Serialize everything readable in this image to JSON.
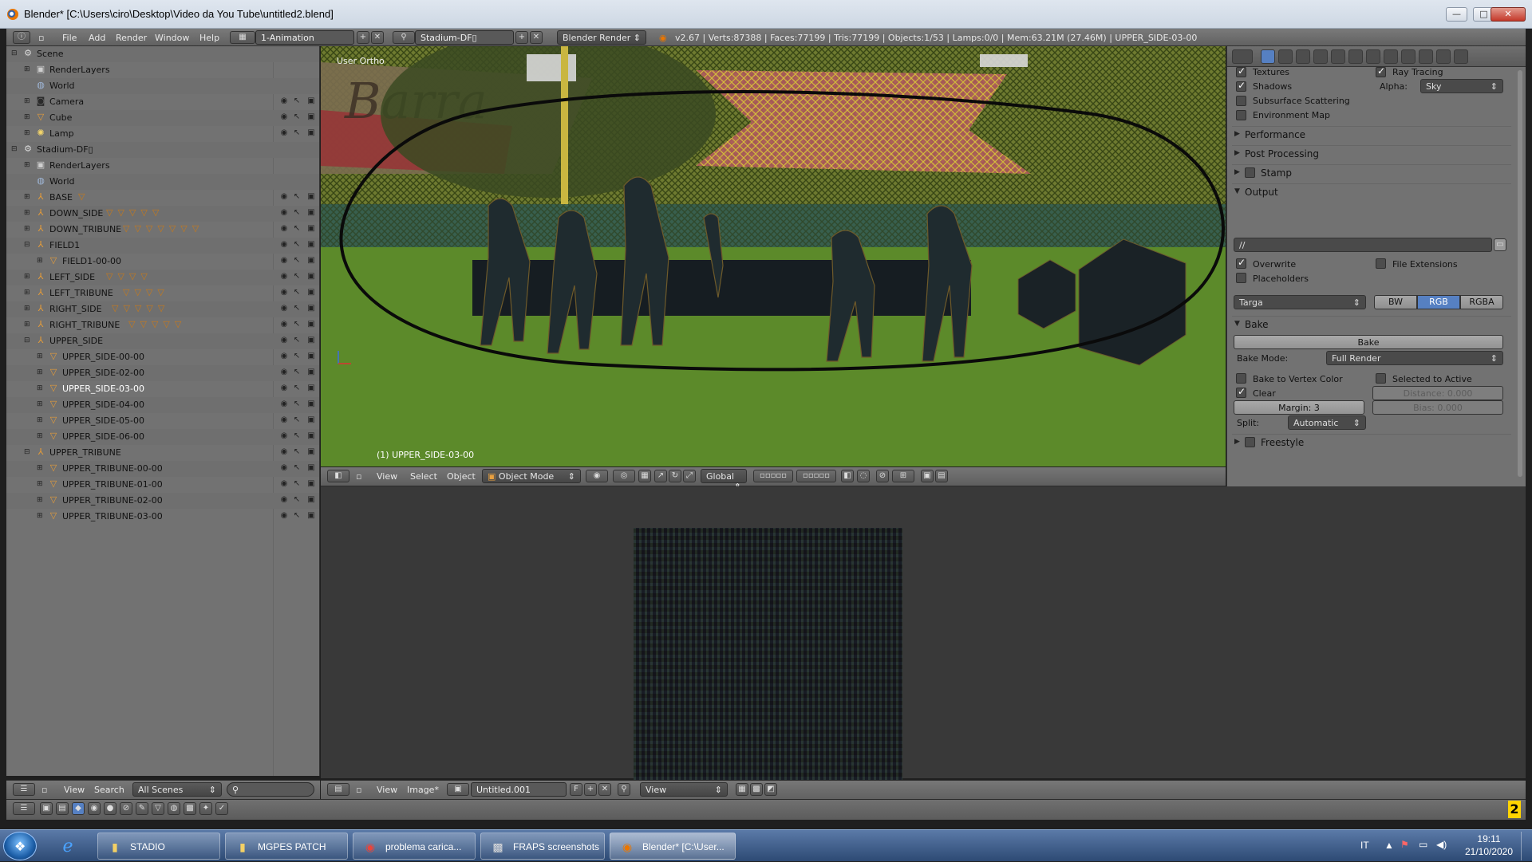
{
  "window": {
    "title": "Blender* [C:\\Users\\ciro\\Desktop\\Video da You Tube\\untitled2.blend]",
    "minimize_glyph": "—",
    "maximize_glyph": "□",
    "close_glyph": "✕"
  },
  "info_header": {
    "menus": [
      "File",
      "Add",
      "Render",
      "Window",
      "Help"
    ],
    "screen_layout": "1-Animation",
    "scene": "Stadium-DF▯",
    "render_engine": "Blender Render",
    "stats": "v2.67 | Verts:87388 | Faces:77199 | Tris:77199 | Objects:1/53 | Lamps:0/0 | Mem:63.21M (27.46M) | UPPER_SIDE-03-00"
  },
  "outliner": {
    "rows": [
      {
        "label": "Scene",
        "icon": "scene-icon",
        "depth": 0,
        "expanded": true,
        "extra": "",
        "vis": false
      },
      {
        "label": "RenderLayers",
        "icon": "renderlayers-icon",
        "depth": 1,
        "expanded": false,
        "extra": "",
        "vis": false
      },
      {
        "label": "World",
        "icon": "world-icon",
        "depth": 1,
        "expanded": null,
        "extra": "",
        "vis": false
      },
      {
        "label": "Camera",
        "icon": "camera-icon",
        "depth": 1,
        "expanded": false,
        "extra": "",
        "vis": true
      },
      {
        "label": "Cube",
        "icon": "mesh-icon",
        "depth": 1,
        "expanded": false,
        "extra": "",
        "vis": true
      },
      {
        "label": "Lamp",
        "icon": "lamp-icon",
        "depth": 1,
        "expanded": false,
        "extra": "",
        "vis": true
      },
      {
        "label": "Stadium-DF▯",
        "icon": "scene-icon",
        "depth": 0,
        "expanded": true,
        "extra": "",
        "vis": false
      },
      {
        "label": "RenderLayers",
        "icon": "renderlayers-icon",
        "depth": 1,
        "expanded": false,
        "extra": "",
        "vis": false
      },
      {
        "label": "World",
        "icon": "world-icon",
        "depth": 1,
        "expanded": null,
        "extra": "",
        "vis": false
      },
      {
        "label": "BASE",
        "icon": "empty-icon",
        "depth": 1,
        "expanded": false,
        "extra": "▽",
        "vis": true
      },
      {
        "label": "DOWN_SIDE",
        "icon": "empty-icon",
        "depth": 1,
        "expanded": false,
        "extra": "▽▽▽▽▽",
        "vis": true
      },
      {
        "label": "DOWN_TRIBUNE",
        "icon": "empty-icon",
        "depth": 1,
        "expanded": false,
        "extra": "▽▽▽▽▽▽▽",
        "vis": true
      },
      {
        "label": "FIELD1",
        "icon": "empty-icon",
        "depth": 1,
        "expanded": true,
        "extra": "",
        "vis": true
      },
      {
        "label": "FIELD1-00-00",
        "icon": "mesh-icon",
        "depth": 2,
        "expanded": false,
        "extra": "",
        "vis": true
      },
      {
        "label": "LEFT_SIDE",
        "icon": "empty-icon",
        "depth": 1,
        "expanded": false,
        "extra": "▽▽▽▽",
        "vis": true
      },
      {
        "label": "LEFT_TRIBUNE",
        "icon": "empty-icon",
        "depth": 1,
        "expanded": false,
        "extra": "▽▽▽▽",
        "vis": true
      },
      {
        "label": "RIGHT_SIDE",
        "icon": "empty-icon",
        "depth": 1,
        "expanded": false,
        "extra": "▽▽▽▽▽",
        "vis": true
      },
      {
        "label": "RIGHT_TRIBUNE",
        "icon": "empty-icon",
        "depth": 1,
        "expanded": false,
        "extra": "▽▽▽▽▽",
        "vis": true
      },
      {
        "label": "UPPER_SIDE",
        "icon": "empty-icon",
        "depth": 1,
        "expanded": true,
        "extra": "",
        "vis": true
      },
      {
        "label": "UPPER_SIDE-00-00",
        "icon": "mesh-icon",
        "depth": 2,
        "expanded": false,
        "extra": "",
        "vis": true
      },
      {
        "label": "UPPER_SIDE-02-00",
        "icon": "mesh-icon",
        "depth": 2,
        "expanded": false,
        "extra": "",
        "vis": true
      },
      {
        "label": "UPPER_SIDE-03-00",
        "icon": "mesh-icon",
        "depth": 2,
        "expanded": false,
        "extra": "",
        "vis": true,
        "selected": true
      },
      {
        "label": "UPPER_SIDE-04-00",
        "icon": "mesh-icon",
        "depth": 2,
        "expanded": false,
        "extra": "",
        "vis": true
      },
      {
        "label": "UPPER_SIDE-05-00",
        "icon": "mesh-icon",
        "depth": 2,
        "expanded": false,
        "extra": "",
        "vis": true
      },
      {
        "label": "UPPER_SIDE-06-00",
        "icon": "mesh-icon",
        "depth": 2,
        "expanded": false,
        "extra": "",
        "vis": true
      },
      {
        "label": "UPPER_TRIBUNE",
        "icon": "empty-icon",
        "depth": 1,
        "expanded": true,
        "extra": "",
        "vis": true
      },
      {
        "label": "UPPER_TRIBUNE-00-00",
        "icon": "mesh-icon",
        "depth": 2,
        "expanded": false,
        "extra": "",
        "vis": true
      },
      {
        "label": "UPPER_TRIBUNE-01-00",
        "icon": "mesh-icon",
        "depth": 2,
        "expanded": false,
        "extra": "",
        "vis": true
      },
      {
        "label": "UPPER_TRIBUNE-02-00",
        "icon": "mesh-icon",
        "depth": 2,
        "expanded": false,
        "extra": "",
        "vis": true
      },
      {
        "label": "UPPER_TRIBUNE-03-00",
        "icon": "mesh-icon",
        "depth": 2,
        "expanded": false,
        "extra": "",
        "vis": true
      }
    ],
    "footer": {
      "view": "View",
      "search": "Search",
      "display_mode": "All Scenes"
    }
  },
  "viewport": {
    "view_label": "User Ortho",
    "banner_text": "Barra",
    "selected_object": "(1) UPPER_SIDE-03-00",
    "header": {
      "view": "View",
      "select": "Select",
      "object": "Object",
      "mode": "Object Mode",
      "orientation": "Global"
    }
  },
  "image_editor": {
    "header": {
      "view": "View",
      "image": "Image*",
      "image_name": "Untitled.001",
      "fake_user": "F",
      "display": "View"
    }
  },
  "properties": {
    "textures": {
      "label": "Textures",
      "checked": true
    },
    "ray_tracing": {
      "label": "Ray Tracing",
      "checked": true
    },
    "shadows": {
      "label": "Shadows",
      "checked": true
    },
    "alpha": {
      "label": "Alpha:",
      "value": "Sky"
    },
    "subsurface": {
      "label": "Subsurface Scattering",
      "checked": false
    },
    "env_map": {
      "label": "Environment Map",
      "checked": false
    },
    "sections": {
      "performance": "Performance",
      "post_processing": "Post Processing",
      "stamp": "Stamp",
      "output": "Output",
      "bake": "Bake",
      "freestyle": "Freestyle"
    },
    "output": {
      "path": "//",
      "overwrite": {
        "label": "Overwrite",
        "checked": true
      },
      "file_extensions": {
        "label": "File Extensions",
        "checked": false
      },
      "placeholders": {
        "label": "Placeholders",
        "checked": false
      },
      "format": "Targa",
      "color_modes": [
        "BW",
        "RGB",
        "RGBA"
      ],
      "color_mode_selected": "RGB"
    },
    "bake": {
      "button": "Bake",
      "mode_label": "Bake Mode:",
      "mode_value": "Full Render",
      "vertex_color": {
        "label": "Bake to Vertex Color",
        "checked": false
      },
      "selected_to_active": {
        "label": "Selected to Active",
        "checked": false
      },
      "clear": {
        "label": "Clear",
        "checked": true
      },
      "distance": "Distance: 0.000",
      "margin": "Margin: 3",
      "bias": "Bias: 0.000",
      "split_label": "Split:",
      "split_value": "Automatic"
    }
  },
  "timeline": {
    "badge": "2"
  },
  "taskbar": {
    "start_glyph": "❖",
    "items": [
      {
        "label": "STADIO",
        "icon": "folder-icon"
      },
      {
        "label": "MGPES PATCH",
        "icon": "folder-icon"
      },
      {
        "label": "problema carica...",
        "icon": "chrome-icon"
      },
      {
        "label": "FRAPS screenshots",
        "icon": "fraps-icon"
      },
      {
        "label": "Blender* [C:\\User...",
        "icon": "blender-icon"
      }
    ],
    "lang": "IT",
    "time": "19:11",
    "date": "21/10/2020"
  },
  "colors": {
    "accent": "#5680c2",
    "field_green": "#5c8a2a",
    "outliner_bg": "#727272"
  }
}
